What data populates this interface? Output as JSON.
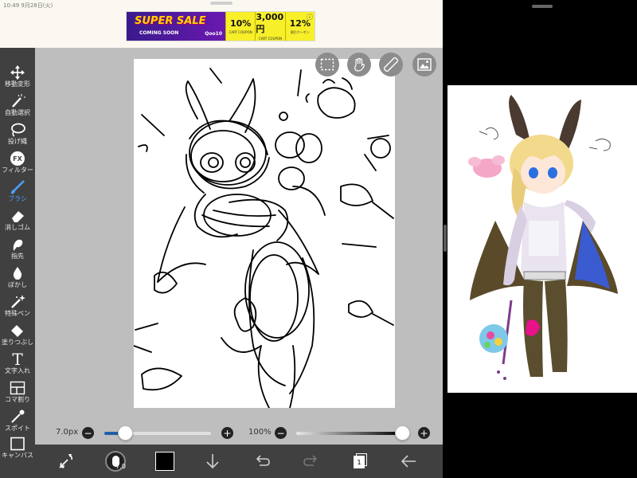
{
  "status": {
    "time": "10:49 9月28日(火)"
  },
  "ad": {
    "title": "SUPER SALE",
    "subtitle": "COMING SOON",
    "brand": "Qoo10",
    "info_icon": "info-icon",
    "coupons": [
      {
        "value": "10%",
        "label": "CART COUPON"
      },
      {
        "value": "3,000円",
        "label": "CART COUPON"
      },
      {
        "value": "12%",
        "label": "割引クーポン"
      }
    ]
  },
  "toolbar": {
    "items": [
      {
        "label": "移動変形",
        "icon": "move-icon"
      },
      {
        "label": "自動選択",
        "icon": "magic-wand-icon"
      },
      {
        "label": "投げ縄",
        "icon": "lasso-icon"
      },
      {
        "label": "フィルター",
        "icon": "fx-icon",
        "icon_text": "FX"
      },
      {
        "label": "ブラシ",
        "icon": "brush-icon",
        "active": true
      },
      {
        "label": "消しゴム",
        "icon": "eraser-icon"
      },
      {
        "label": "指先",
        "icon": "smudge-icon"
      },
      {
        "label": "ぼかし",
        "icon": "blur-icon"
      },
      {
        "label": "特殊ペン",
        "icon": "special-pen-icon"
      },
      {
        "label": "塗りつぶし",
        "icon": "fill-icon"
      },
      {
        "label": "文字入れ",
        "icon": "text-icon",
        "icon_text": "T"
      },
      {
        "label": "コマ割り",
        "icon": "frame-divider-icon"
      },
      {
        "label": "スポイト",
        "icon": "eyedropper-icon"
      },
      {
        "label": "キャンバス",
        "icon": "canvas-icon"
      }
    ]
  },
  "floating_buttons": [
    "selection-icon",
    "hand-icon",
    "ruler-icon",
    "image-icon"
  ],
  "sliders": {
    "brush_size": {
      "label": "7.0px",
      "value_fraction": 0.2
    },
    "opacity": {
      "label": "100%",
      "value_fraction": 1.0
    }
  },
  "bottom_bar": {
    "brush_size_badge": "7.0",
    "layer_count": "1",
    "icons": [
      "swap-tools-icon",
      "brush-size-icon",
      "color-swatch-icon",
      "download-icon",
      "undo-icon",
      "redo-icon",
      "layers-icon",
      "back-icon"
    ]
  },
  "colors": {
    "accent": "#4aa3ff",
    "toolbar_bg": "#404040",
    "canvas_bg": "#bebebe",
    "current_color": "#000000"
  }
}
